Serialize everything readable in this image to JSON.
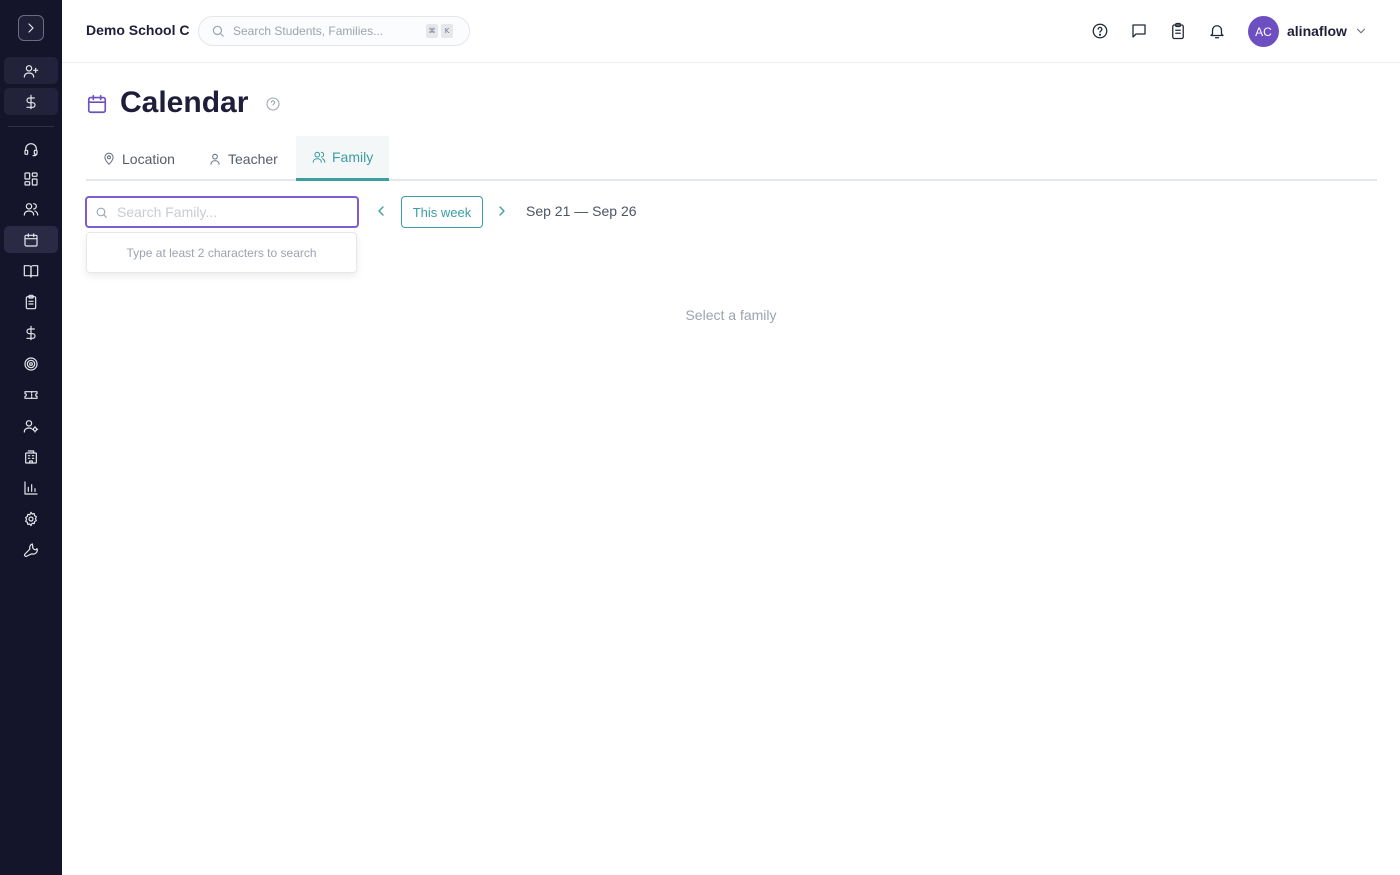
{
  "header": {
    "school_name": "Demo School C",
    "search_placeholder": "Search Students, Families...",
    "shortcut_keys": [
      "⌘",
      "K"
    ],
    "user": {
      "initials": "AC",
      "name": "alinaflow"
    }
  },
  "sidebar": {
    "items": [
      {
        "icon": "user-plus-icon"
      },
      {
        "icon": "dollar-icon"
      },
      {
        "icon": "headset-icon"
      },
      {
        "icon": "dashboard-icon"
      },
      {
        "icon": "users-icon"
      },
      {
        "icon": "calendar-icon",
        "active": true
      },
      {
        "icon": "book-icon"
      },
      {
        "icon": "clipboard-icon"
      },
      {
        "icon": "dollar-icon"
      },
      {
        "icon": "target-icon"
      },
      {
        "icon": "ticket-icon"
      },
      {
        "icon": "user-cog-icon"
      },
      {
        "icon": "building-icon"
      },
      {
        "icon": "bar-chart-icon"
      },
      {
        "icon": "gear-icon"
      },
      {
        "icon": "wrench-icon"
      }
    ]
  },
  "page": {
    "title": "Calendar",
    "tabs": [
      {
        "label": "Location",
        "icon": "map-pin-icon"
      },
      {
        "label": "Teacher",
        "icon": "user-icon"
      },
      {
        "label": "Family",
        "icon": "users-icon",
        "active": true
      }
    ],
    "family_search_placeholder": "Search Family...",
    "dropdown_hint": "Type at least 2 characters to search",
    "this_week_label": "This week",
    "date_range": "Sep 21 — Sep 26",
    "empty_message": "Select a family"
  },
  "colors": {
    "sidebar_bg": "#14142b",
    "accent_teal": "#3a9ea3",
    "accent_purple": "#6d4fc2",
    "focus_border": "#7b5ed6"
  }
}
